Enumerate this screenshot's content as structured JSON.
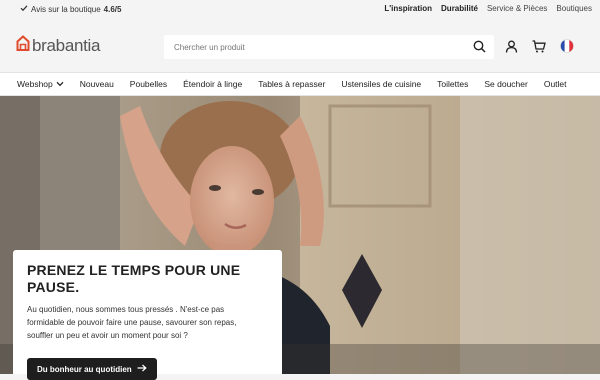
{
  "topbar": {
    "rating_prefix": "Avis sur la boutique",
    "rating_value": "4.6/5",
    "links": [
      "L'inspiration",
      "Durabilité",
      "Service & Pièces",
      "Boutiques"
    ]
  },
  "header": {
    "logo_text": "brabantia",
    "search_placeholder": "Chercher un produit",
    "language": "FR"
  },
  "nav": {
    "items": [
      "Webshop",
      "Nouveau",
      "Poubelles",
      "Étendoir à linge",
      "Tables à repasser",
      "Ustensiles de cuisine",
      "Toilettes",
      "Se doucher",
      "Outlet"
    ]
  },
  "hero": {
    "title": "PRENEZ LE TEMPS POUR UNE PAUSE.",
    "body": "Au quotidien, nous sommes tous pressés . N'est-ce pas formidable de pouvoir faire une pause, savourer son repas, souffler un peu et avoir un moment pour soi ?",
    "cta_label": "Du bonheur au quotidien"
  },
  "colors": {
    "brand": "#e04b2e",
    "cta_bg": "#1e1e1e"
  }
}
